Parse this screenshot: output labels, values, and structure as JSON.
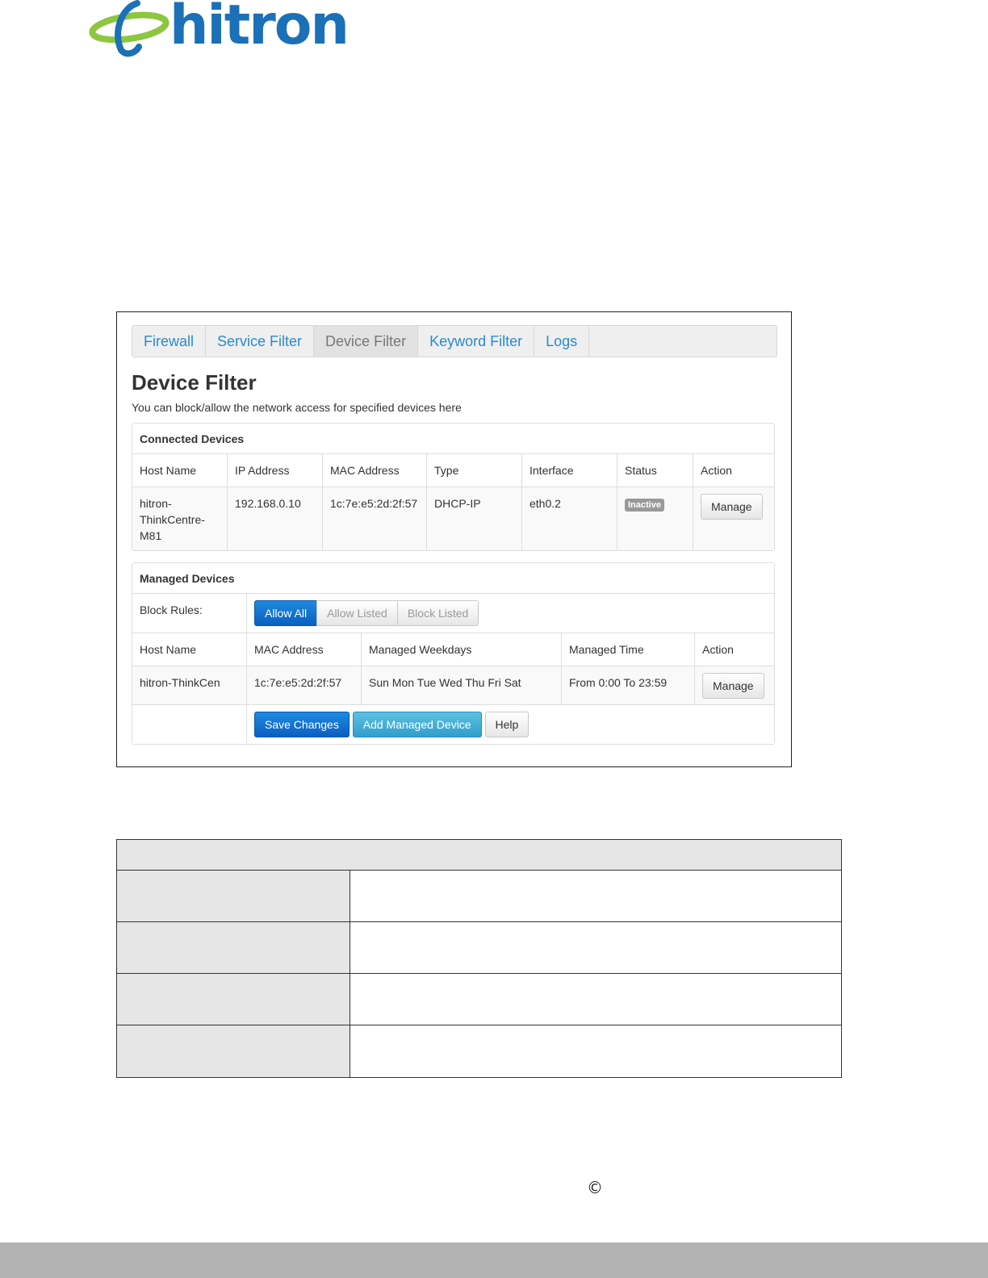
{
  "brand": {
    "logo_text": "hitron",
    "logo_color": "#1b70b8",
    "swoosh_color": "#8dc63f"
  },
  "tabs": [
    {
      "label": "Firewall"
    },
    {
      "label": "Service Filter"
    },
    {
      "label": "Device Filter",
      "active": true
    },
    {
      "label": "Keyword Filter"
    },
    {
      "label": "Logs"
    }
  ],
  "page": {
    "title": "Device Filter",
    "description": "You can block/allow the network access for specified devices here"
  },
  "connected": {
    "heading": "Connected Devices",
    "columns": [
      "Host Name",
      "IP Address",
      "MAC Address",
      "Type",
      "Interface",
      "Status",
      "Action"
    ],
    "row": {
      "host": "hitron-ThinkCentre-M81",
      "ip": "192.168.0.10",
      "mac": "1c:7e:e5:2d:2f:57",
      "type": "DHCP-IP",
      "interface": "eth0.2",
      "status": "Inactive",
      "action": "Manage"
    }
  },
  "managed": {
    "heading": "Managed Devices",
    "block_rules_label": "Block Rules:",
    "block_rules": [
      "Allow All",
      "Allow Listed",
      "Block Listed"
    ],
    "block_rules_selected": "Allow All",
    "columns": [
      "Host Name",
      "MAC Address",
      "Managed Weekdays",
      "Managed Time",
      "Action"
    ],
    "row": {
      "host": "hitron-ThinkCen",
      "mac": "1c:7e:e5:2d:2f:57",
      "weekdays": "Sun Mon Tue Wed Thu Fri Sat",
      "time": "From 0:00 To 23:59",
      "action": "Manage"
    },
    "buttons": {
      "save": "Save Changes",
      "add": "Add Managed Device",
      "help": "Help"
    }
  },
  "footer": {
    "copyright_symbol": "©"
  }
}
